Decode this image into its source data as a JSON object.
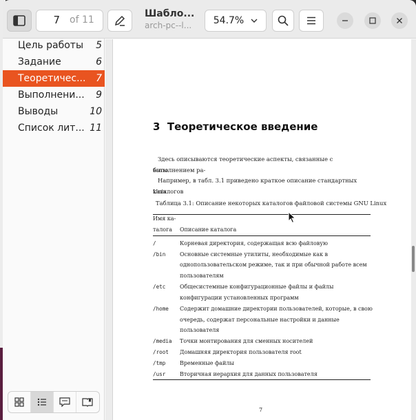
{
  "header": {
    "current_page": "7",
    "page_total": "of 11",
    "doc_title": "Шабло...",
    "doc_subtitle": "arch-pc--l...",
    "zoom_level": "54.7%"
  },
  "sidebar": {
    "items": [
      {
        "label": "Цель работы",
        "page": "5",
        "active": false
      },
      {
        "label": "Задание",
        "page": "6",
        "active": false
      },
      {
        "label": "Теоретичес...",
        "page": "7",
        "active": true
      },
      {
        "label": "Выполнени...",
        "page": "9",
        "active": false
      },
      {
        "label": "Выводы",
        "page": "10",
        "active": false
      },
      {
        "label": "Список лит...",
        "page": "11",
        "active": false
      }
    ],
    "view_buttons": [
      "thumbnails-icon",
      "outline-icon",
      "annotations-icon",
      "bookmarks-icon"
    ]
  },
  "document": {
    "section_number": "3",
    "section_title": "Теоретическое введение",
    "para1_line1": "Здесь описываются теоретические аспекты, связанные с выполнением ра-",
    "para1_line2": "боты.",
    "para2_line1": "Например, в табл. 3.1 приведено краткое описание стандартных каталогов",
    "para2_line2": "Unix.",
    "table_caption": "Таблица 3.1: Описание некоторых каталогов файловой системы GNU Linux",
    "table_header": {
      "col1_line1": "Имя ка-",
      "col1_line2": "талога",
      "col2": "Описание каталога"
    },
    "rows": [
      {
        "dir": "/",
        "desc": [
          "Корневая директория, содержащая всю файловую"
        ]
      },
      {
        "dir": "/bin",
        "desc": [
          "Основные системные утилиты, необходимые как в",
          "однопользовательском режиме, так и при обычной работе всем",
          "пользователям"
        ]
      },
      {
        "dir": "/etc",
        "desc": [
          "Общесистемные конфигурационные файлы и файлы",
          "конфигурации установленных программ"
        ]
      },
      {
        "dir": "/home",
        "desc": [
          "Содержит домашние директории пользователей, которые, в свою",
          "очередь, содержат персональные настройки и данные",
          "пользователя"
        ]
      },
      {
        "dir": "/media",
        "desc": [
          "Точки монтирования для сменных носителей"
        ]
      },
      {
        "dir": "/root",
        "desc": [
          "Домашняя директория пользователя root"
        ]
      },
      {
        "dir": "/tmp",
        "desc": [
          "Временные файлы"
        ]
      },
      {
        "dir": "/usr",
        "desc": [
          "Вторичная иерархия для данных пользователя"
        ]
      }
    ],
    "page_number": "7"
  },
  "colors": {
    "accent": "#e95420"
  }
}
